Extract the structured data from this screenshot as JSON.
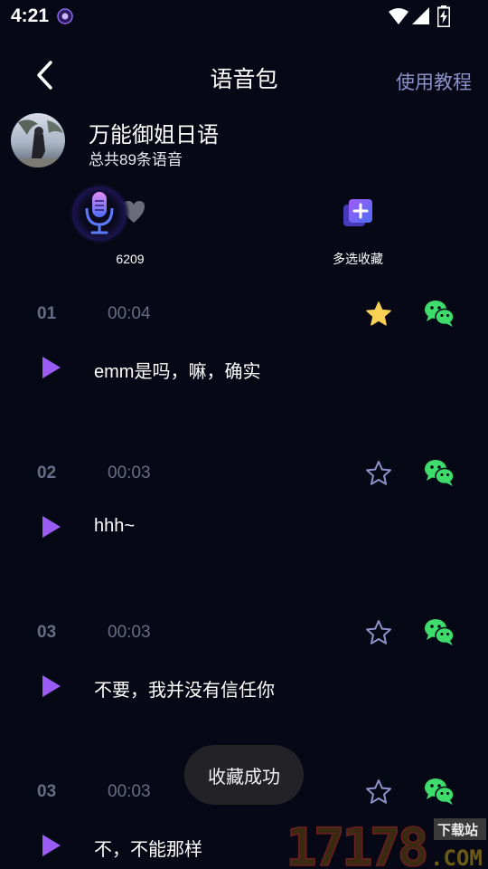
{
  "status": {
    "time": "4:21"
  },
  "header": {
    "title": "语音包",
    "tutorial_label": "使用教程"
  },
  "profile": {
    "pack_name": "万能御姐日语",
    "pack_count": "总共89条语音"
  },
  "actions": {
    "like_count": "6209",
    "collect_label": "多选收藏"
  },
  "voices": [
    {
      "num": "01",
      "duration": "00:04",
      "text": "emm是吗，嘛，确实",
      "starred": true
    },
    {
      "num": "02",
      "duration": "00:03",
      "text": "hhh~",
      "starred": false
    },
    {
      "num": "03",
      "duration": "00:03",
      "text": "不要，我并没有信任你",
      "starred": false
    },
    {
      "num": "03",
      "duration": "00:03",
      "text": "不，不能那样",
      "starred": false
    }
  ],
  "toast": {
    "message": "收藏成功"
  },
  "watermark": {
    "number": "17178",
    "site": "下载站",
    "domain": ".COM"
  },
  "colors": {
    "background": "#070815",
    "accent_purple": "#8b5cf6",
    "star_active": "#f7d154",
    "star_inactive": "#8e92c9",
    "wechat_green": "#3ddc6b",
    "muted_text": "#6a6c85"
  },
  "icons": {
    "back": "back-arrow-icon",
    "microphone": "microphone-icon",
    "heart": "heart-icon",
    "collect": "add-collection-icon",
    "star": "star-icon",
    "wechat": "wechat-icon",
    "play": "play-icon"
  }
}
